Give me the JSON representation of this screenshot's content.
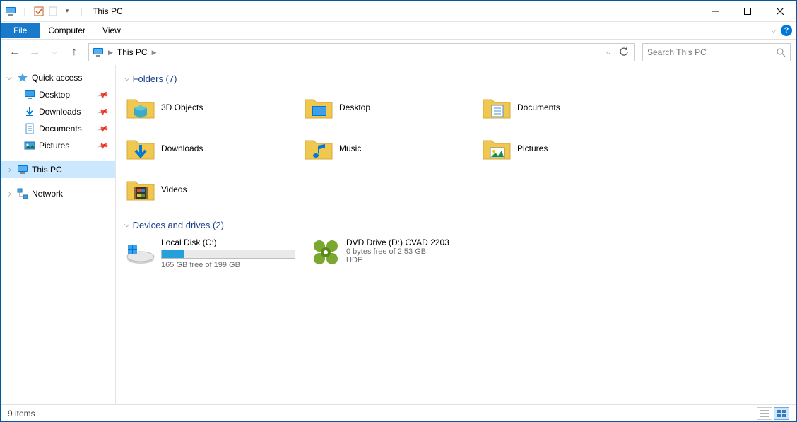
{
  "title": "This PC",
  "ribbon": {
    "file": "File",
    "computer": "Computer",
    "view": "View"
  },
  "breadcrumb": {
    "loc": "This PC"
  },
  "search": {
    "placeholder": "Search This PC"
  },
  "tree": {
    "quick_access": "Quick access",
    "desktop": "Desktop",
    "downloads": "Downloads",
    "documents": "Documents",
    "pictures": "Pictures",
    "this_pc": "This PC",
    "network": "Network"
  },
  "groups": {
    "folders_hdr": "Folders (7)",
    "drives_hdr": "Devices and drives (2)"
  },
  "folders": {
    "objects3d": "3D Objects",
    "desktop": "Desktop",
    "documents": "Documents",
    "downloads": "Downloads",
    "music": "Music",
    "pictures": "Pictures",
    "videos": "Videos"
  },
  "drives": {
    "c": {
      "name": "Local Disk (C:)",
      "sub": "165 GB free of 199 GB",
      "fill_pct": 17
    },
    "d": {
      "name": "DVD Drive (D:) CVAD 2203",
      "sub1": "0 bytes free of 2.53 GB",
      "sub2": "UDF"
    }
  },
  "status": {
    "items": "9 items"
  }
}
